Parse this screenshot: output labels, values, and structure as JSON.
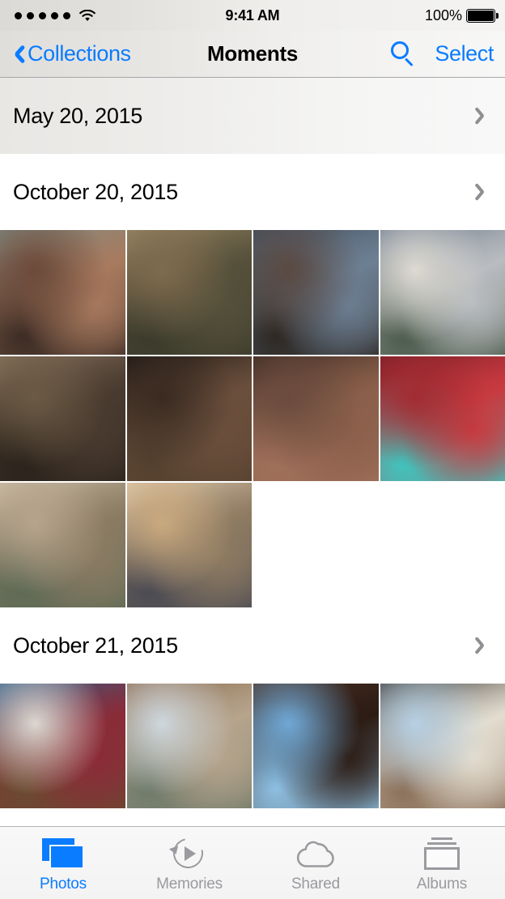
{
  "status_bar": {
    "signal_dots": 5,
    "wifi_icon": "wifi-icon",
    "time": "9:41 AM",
    "battery_percent": "100%",
    "battery_icon": "battery-full-icon"
  },
  "nav_bar": {
    "back_icon": "chevron-left-icon",
    "back_label": "Collections",
    "title": "Moments",
    "search_icon": "search-icon",
    "select_label": "Select"
  },
  "accent_color": "#0a7cff",
  "chevron_color": "#8e8e93",
  "moments": [
    {
      "date": "May 20, 2015",
      "shaded": true,
      "disclosure_icon": "chevron-right-icon",
      "photos": []
    },
    {
      "date": "October 20, 2015",
      "shaded": false,
      "disclosure_icon": "chevron-right-icon",
      "photos": [
        {
          "alt": "woman and girl nose to nose outdoors",
          "c1": "#6d4a3a",
          "c2": "#a87a5e",
          "c3": "#7e8d86",
          "c4": "#3a2b24"
        },
        {
          "alt": "girl and woman smiling by fence",
          "c1": "#7f6b4e",
          "c2": "#55503a",
          "c3": "#9a8766",
          "c4": "#3b3b2c"
        },
        {
          "alt": "girl resting on bearded man shoulder",
          "c1": "#5b4a42",
          "c2": "#6d7f93",
          "c3": "#44515f",
          "c4": "#2c2722"
        },
        {
          "alt": "man and child on couch by window",
          "c1": "#dedad3",
          "c2": "#b9bcc0",
          "c3": "#6d7b8c",
          "c4": "#4a5a4a"
        },
        {
          "alt": "woman holding baby by bookshelf",
          "c1": "#6b5a44",
          "c2": "#4a3b30",
          "c3": "#8a7560",
          "c4": "#2b231c"
        },
        {
          "alt": "boy in profile dark background",
          "c1": "#3a2b22",
          "c2": "#6b4f3c",
          "c3": "#1e1814",
          "c4": "#55412f"
        },
        {
          "alt": "mother kissing sleeping girl",
          "c1": "#6a4b3e",
          "c2": "#8a5f4a",
          "c3": "#3b2a23",
          "c4": "#a0705a"
        },
        {
          "alt": "boy lying on red plaid blanket",
          "c1": "#a32b32",
          "c2": "#c83a3f",
          "c3": "#7a1f28",
          "c4": "#3ec6c0"
        },
        {
          "alt": "children smiling in sunlight",
          "c1": "#b7a48c",
          "c2": "#8b7b63",
          "c3": "#cdbfa8",
          "c4": "#5e6a55"
        },
        {
          "alt": "girl and woman laughing close up",
          "c1": "#caa97e",
          "c2": "#8e7b62",
          "c3": "#e0cdb2",
          "c4": "#4a4a52"
        }
      ]
    },
    {
      "date": "October 21, 2015",
      "shaded": false,
      "disclosure_icon": "chevron-right-icon",
      "photos": [
        {
          "alt": "group of five people against white wall",
          "c1": "#dcd7d0",
          "c2": "#8b2b38",
          "c3": "#2f5f86",
          "c4": "#6b4a31"
        },
        {
          "alt": "woman smiling on rooftop at dusk",
          "c1": "#cfd7dd",
          "c2": "#b6a48c",
          "c3": "#8a6a4e",
          "c4": "#6f7a6a"
        },
        {
          "alt": "man in profile against blue sky",
          "c1": "#6fa8d6",
          "c2": "#2c1c14",
          "c3": "#4a3024",
          "c4": "#8fc0e2"
        },
        {
          "alt": "woman in knit pom hat laughing",
          "c1": "#b6d0e4",
          "c2": "#e3ddd0",
          "c3": "#3c3a36",
          "c4": "#8a6f58"
        }
      ]
    }
  ],
  "tab_bar": {
    "items": [
      {
        "label": "Photos",
        "icon": "photos-stack-icon",
        "active": true
      },
      {
        "label": "Memories",
        "icon": "memories-replay-icon",
        "active": false
      },
      {
        "label": "Shared",
        "icon": "cloud-icon",
        "active": false
      },
      {
        "label": "Albums",
        "icon": "albums-stack-icon",
        "active": false
      }
    ]
  }
}
